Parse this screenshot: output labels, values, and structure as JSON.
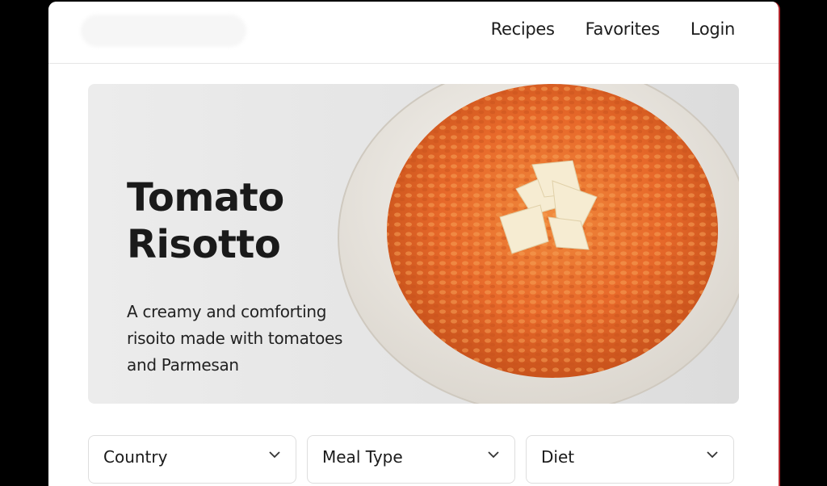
{
  "nav": {
    "items": [
      {
        "label": "Recipes"
      },
      {
        "label": "Favorites"
      },
      {
        "label": "Login"
      }
    ]
  },
  "hero": {
    "title": "Tomato Risotto",
    "subtitle": "A creamy and comforting risoito made with tomatoes and Parmesan",
    "image": "risotto-bowl-image"
  },
  "filters": [
    {
      "label": "Country",
      "icon": "chevron-down-icon"
    },
    {
      "label": "Meal Type",
      "icon": "chevron-down-icon"
    },
    {
      "label": "Diet",
      "icon": "chevron-down-icon"
    }
  ],
  "colors": {
    "risotto": "#e8692a",
    "bowl": "#f1eee8",
    "hero_bg": "#e6e6e6",
    "accent_edge": "#b3262c"
  }
}
